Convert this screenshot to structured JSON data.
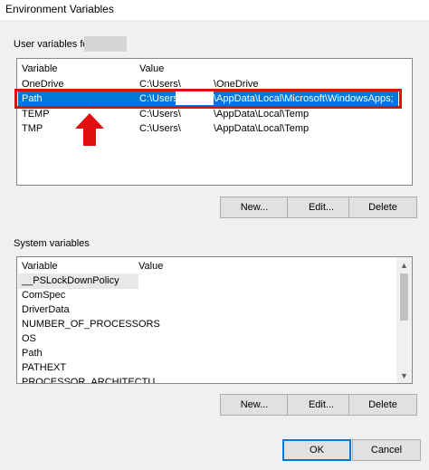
{
  "window": {
    "title": "Environment Variables"
  },
  "user_vars": {
    "group_label": "User variables for",
    "columns": {
      "variable": "Variable",
      "value": "Value"
    },
    "rows": [
      {
        "variable": "OneDrive",
        "value_prefix": "C:\\Users\\",
        "value_suffix": "\\OneDrive"
      },
      {
        "variable": "Path",
        "value_prefix": "C:\\Users\\",
        "value_suffix": "\\AppData\\Local\\Microsoft\\WindowsApps;"
      },
      {
        "variable": "TEMP",
        "value_prefix": "C:\\Users\\",
        "value_suffix": "\\AppData\\Local\\Temp"
      },
      {
        "variable": "TMP",
        "value_prefix": "C:\\Users\\",
        "value_suffix": "\\AppData\\Local\\Temp"
      }
    ],
    "selected_row": 1,
    "buttons": {
      "new": "New...",
      "edit": "Edit...",
      "delete": "Delete"
    }
  },
  "system_vars": {
    "group_label": "System variables",
    "columns": {
      "variable": "Variable",
      "value": "Value"
    },
    "rows": [
      {
        "variable": "__PSLockDownPolicy"
      },
      {
        "variable": "ComSpec"
      },
      {
        "variable": "DriverData"
      },
      {
        "variable": "NUMBER_OF_PROCESSORS"
      },
      {
        "variable": "OS"
      },
      {
        "variable": "Path"
      },
      {
        "variable": "PATHEXT"
      },
      {
        "variable": "PROCESSOR_ARCHITECTU..."
      }
    ],
    "buttons": {
      "new": "New...",
      "edit": "Edit...",
      "delete": "Delete"
    }
  },
  "footer": {
    "ok": "OK",
    "cancel": "Cancel"
  },
  "annotation": {
    "arrow_color": "#e01010",
    "highlight_color": "#e01010"
  },
  "colors": {
    "selection": "#0078d7",
    "default_button_border": "#0078d7"
  }
}
